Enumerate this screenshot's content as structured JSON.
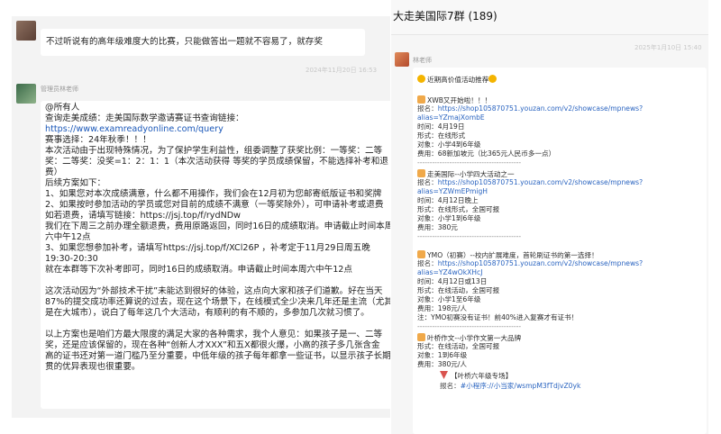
{
  "left_chat": {
    "msg1": {
      "nick": "",
      "text": "不过听说有的高年级难度大的比赛，只能做答出一题就不容易了，就存奖"
    },
    "timestamp": "2024年11月20日 16:53",
    "msg2": {
      "nick": "管理员林老师",
      "lines": [
        "@所有人",
        "查询走美成绩：走美国际数学邀请赛证书查询链接：",
        "https://www.examreadyonline.com/query",
        "赛事选择：24年秋季！！！",
        "本次活动由于出现特殊情况，为了保护学生利益性，组委调整了获奖比例：一等奖：二等",
        "奖：二等奖：没奖=1：2：1：1（本次活动获得   等奖的学员成绩保留，不能选择补考和退",
        "费）",
        "后续方案如下：",
        "1、如果您对本次成绩满意，什么都不用操作，我们会在12月初为您邮寄纸版证书和奖牌",
        "2、如果按时参加活动的学员或您对目前的成绩不满意（一等奖除外），可申请补考或退费",
        "如若退费，请填写链接：https://jsj.top/f/rydNDw",
        "我们在下周三之前办理全额退费，费用原路返回，同时16日的成绩取消。申请截止时间本周",
        "六中午12点",
        "3、如果您想参加补考，请填写https://jsj.top/f/XCl26P ，补考定于11月29日周五晚",
        "19:30-20:30",
        "就在本群等下次补考即可，同时16日的成绩取消。申请截止时间本周六中午12点",
        "",
        "这次活动因为“外部技术干扰”未能达到很好的体验，这点向大家和孩子们道歉。好在当天",
        "87%的提交成功率还算说的过去，现在这个场景下，在线模式全少决来几年还是主流（尤其",
        "是在大城市），说白了每年这几个大活动，有顺利的有不顺的，多参加几次就习惯了。",
        "",
        "以上方案也是咱们方最大限度的满足大家的各种需求，我个人意见：如果孩子是一、二等",
        "奖，还是应该保留的，现在各种“创新人才XXX”和五X都很火爆，小高的孩子多几张含金",
        "高的证书还对第一道门槛乃至分重要，中低年级的孩子每年都拿一些证书，以显示孩子长期一",
        "贯的优异表现也很重要。"
      ]
    }
  },
  "right_chat": {
    "title": "大走美国际7群 (189)",
    "timestamp": "2025年1月10日 15:40",
    "nick": "林老师",
    "post": {
      "header": "近期高价值活动推荐",
      "items": [
        {
          "title": "XWB又开始啦！！！",
          "link_label": "报名：",
          "link1": "https://shop105870751.youzan.com/v2/showcase/mpnews?",
          "link2": "alias=YZmajXombE",
          "lines": [
            "时间：4月19日",
            "形式：在线形式",
            "对象：小学4到6年级",
            "费用：68新加坡元（比365元人民币多一点）"
          ]
        },
        {
          "title": "走美国际--小学四大活动之一",
          "link_label": "报名：",
          "link1": "https://shop105870751.youzan.com/v2/showcase/mpnews?",
          "link2": "alias=YZWmEPmigH",
          "lines": [
            "时间：4月12日晚上",
            "形式：在线形式，全国可报",
            "对象：小学1到6年级",
            "费用：380元"
          ]
        },
        {
          "title": "YMO（初赛）--校内扩展难度，首轮刷证书的第一选择！",
          "link_label": "报名：",
          "link1": "https://shop105870751.youzan.com/v2/showcase/mpnews?",
          "link2": "alias=YZ4wOkXHcJ",
          "lines": [
            "时间：4月12日或13日",
            "形式：在线活动，全国可报",
            "对象：小学1至6年级",
            "费用：198元/人",
            "注：YMO初赛没有证书！前40%进入复赛才有证书！"
          ]
        },
        {
          "title": "叶桥作文--小学作文第一大品牌",
          "lines": [
            "形式：在线活动，全国可报",
            "对象：1到6年级",
            "费用：380元/人"
          ]
        }
      ],
      "sub_title": "【叶桥六年级专场】",
      "sub_link_label": "报名：",
      "sub_link": "#小程序://小当家/wsmpM3fTdjvZ0yk",
      "separator": "------------------------------------------"
    }
  }
}
